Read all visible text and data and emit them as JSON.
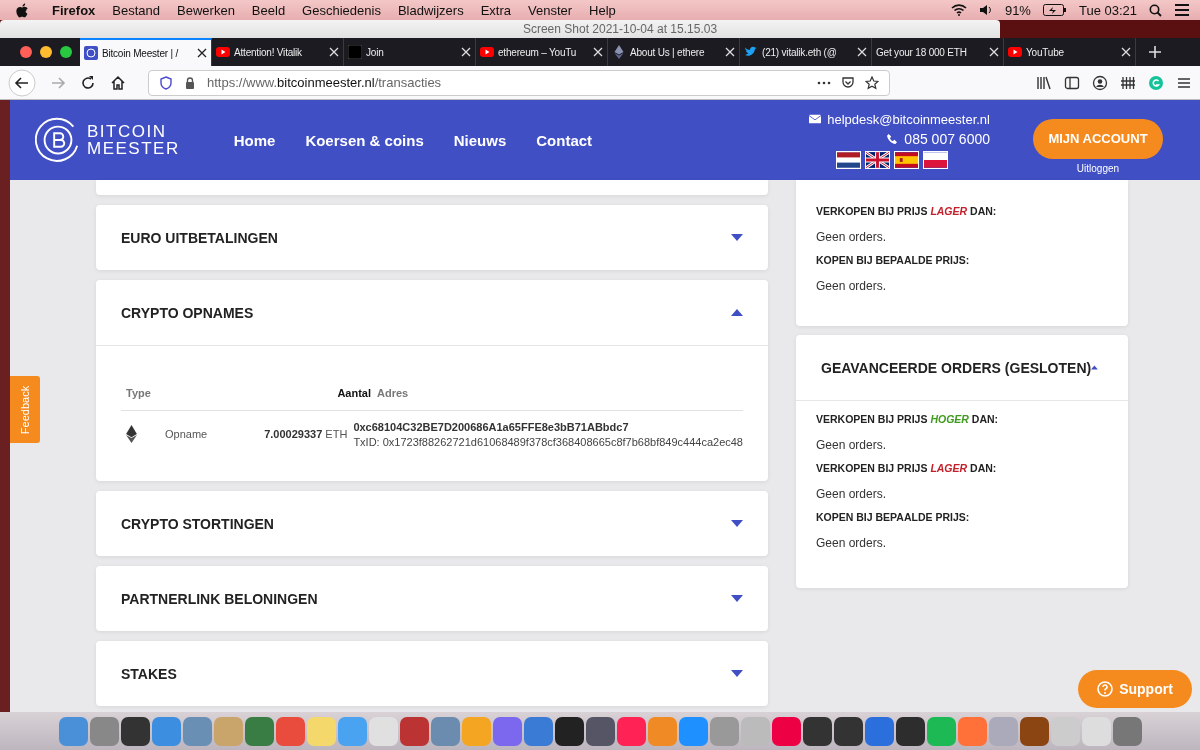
{
  "menu_bar": {
    "app": "Firefox",
    "menus": [
      "Bestand",
      "Bewerken",
      "Beeld",
      "Geschiedenis",
      "Bladwijzers",
      "Extra",
      "Venster",
      "Help"
    ],
    "battery": "91%",
    "clock": "Tue 03:21"
  },
  "background_window": {
    "title": "Screen Shot 2021-10-04 at 15.15.03"
  },
  "tabs": [
    {
      "title": "Bitcoin Meester | /",
      "kind": "site",
      "selected": true
    },
    {
      "title": "Attention! Vitalik",
      "kind": "youtube",
      "selected": false
    },
    {
      "title": "Join",
      "kind": "dark",
      "selected": false
    },
    {
      "title": "ethereum – YouTu",
      "kind": "youtube",
      "selected": false
    },
    {
      "title": "About Us | ethere",
      "kind": "ethereum",
      "selected": false
    },
    {
      "title": "(21) vitalik.eth (@",
      "kind": "twitter",
      "selected": false
    },
    {
      "title": "Get your 18 000 ETH",
      "kind": "plain",
      "selected": false
    },
    {
      "title": "YouTube",
      "kind": "youtube",
      "selected": false
    }
  ],
  "address_bar": {
    "scheme": "https://www.",
    "domain": "bitcoinmeester.nl",
    "path": "/transacties"
  },
  "site": {
    "logo": [
      "BITCOIN",
      "MEESTER"
    ],
    "nav": [
      "Home",
      "Koersen & coins",
      "Nieuws",
      "Contact"
    ],
    "email": "helpdesk@bitcoinmeester.nl",
    "phone": "085 007 6000",
    "languages": [
      {
        "kind": "nl"
      },
      {
        "kind": "gb"
      },
      {
        "kind": "es"
      },
      {
        "kind": "pl"
      }
    ],
    "account_button": "MIJN ACCOUNT",
    "logout": "Uitloggen"
  },
  "sections": [
    {
      "title": "EURO UITBETALINGEN",
      "expanded": false
    },
    {
      "title": "CRYPTO OPNAMES",
      "expanded": true,
      "table": {
        "columns": [
          {
            "label": "Type",
            "sorted": false
          },
          {
            "label": "Aantal",
            "sorted": true
          },
          {
            "label": "Adres",
            "sorted": false
          }
        ],
        "rows": [
          {
            "kind": "ethereum",
            "type": "Opname",
            "amount": "7.00029337",
            "unit": "ETH",
            "address": "0xc68104C32BE7D200686A1a65FFE8e3bB71ABbdc7",
            "txid": "TxID: 0x1723f88262721d61068489f378cf368408665c8f7b68bf849c444ca2ec48"
          }
        ]
      }
    },
    {
      "title": "CRYPTO STORTINGEN",
      "expanded": false
    },
    {
      "title": "PARTNERLINK BELONINGEN",
      "expanded": false
    },
    {
      "title": "STAKES",
      "expanded": false
    }
  ],
  "order_panels": [
    {
      "rules": [
        {
          "label": "VERKOPEN BIJ PRIJS *LAGER* DAN:",
          "kind": "lower",
          "message": "Geen orders."
        },
        {
          "label": "KOPEN BIJ BEPAALDE PRIJS:",
          "kind": "plain",
          "message": "Geen orders."
        }
      ]
    },
    {
      "title": "GEAVANCEERDE ORDERS (GESLOTEN)",
      "expanded": true,
      "rules": [
        {
          "label": "VERKOPEN BIJ PRIJS *HOGER* DAN:",
          "kind": "higher",
          "message": "Geen orders."
        },
        {
          "label": "VERKOPEN BIJ PRIJS *LAGER* DAN:",
          "kind": "lower",
          "message": "Geen orders."
        },
        {
          "label": "KOPEN BIJ BEPAALDE PRIJS:",
          "kind": "plain",
          "message": "Geen orders."
        }
      ]
    }
  ],
  "feedback": "Feedback",
  "support": "Support"
}
